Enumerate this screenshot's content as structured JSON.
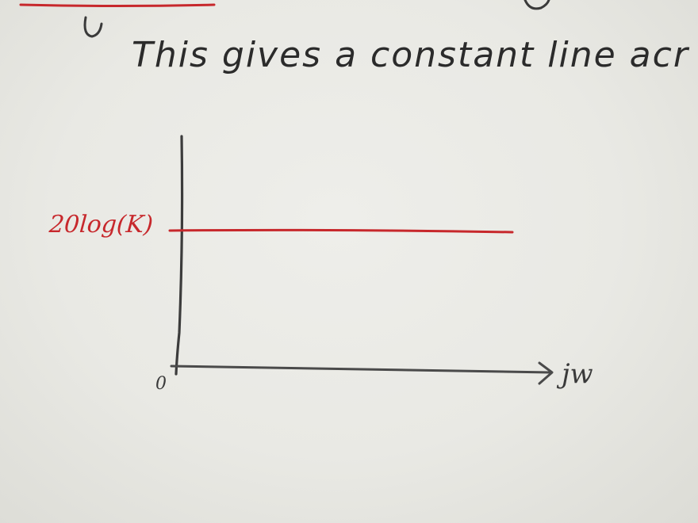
{
  "note": {
    "sentence": "This gives a constant line acr"
  },
  "sketch": {
    "y_label": "20log(K)",
    "x_label": "jw",
    "origin_label": "0",
    "line_color": "#c7282c",
    "ink_color": "#3a3a3a"
  }
}
